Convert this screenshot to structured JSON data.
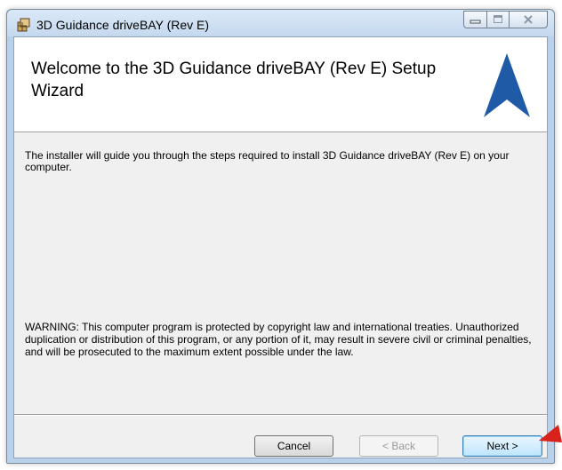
{
  "window": {
    "title": "3D Guidance driveBAY (Rev E)",
    "controls": [
      "minimize-icon",
      "maximize-icon",
      "close-icon"
    ]
  },
  "banner": {
    "title": "Welcome to the 3D Guidance driveBAY (Rev E) Setup Wizard",
    "logo": "triangle-logo",
    "logo_color": "#1f5aa6"
  },
  "body": {
    "intro": "The installer will guide you through the steps required to install 3D Guidance driveBAY (Rev E) on your computer.",
    "warning": "WARNING: This computer program is protected by copyright law and international treaties. Unauthorized duplication or distribution of this program, or any portion of it, may result in severe civil or criminal penalties, and will be prosecuted to the maximum extent possible under the law."
  },
  "buttons": {
    "cancel": "Cancel",
    "back": "< Back",
    "next": "Next >"
  },
  "annotation": {
    "pointer": "red-arrow-icon",
    "color": "#d9221c"
  }
}
